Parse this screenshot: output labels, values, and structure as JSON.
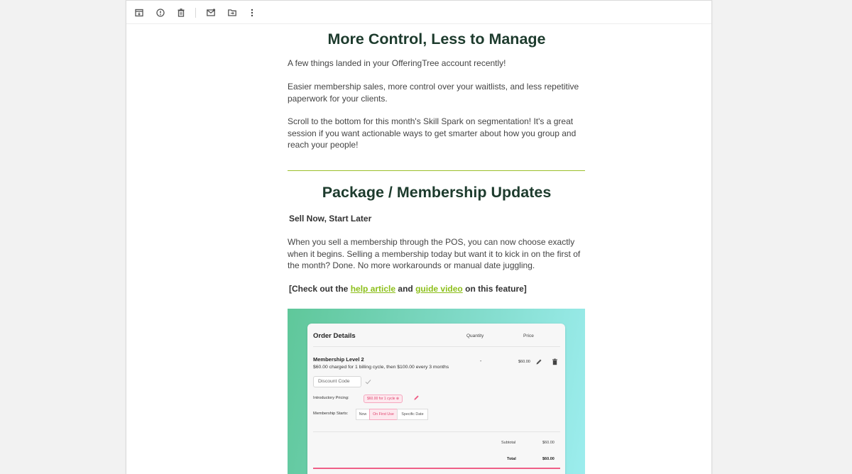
{
  "toolbar": {
    "icons": [
      "archive-icon",
      "report-spam-icon",
      "delete-icon",
      "mark-unread-icon",
      "move-to-icon",
      "more-options-icon"
    ]
  },
  "intro": {
    "title": "More Control, Less to Manage",
    "p1": "A few things landed in your OfferingTree account recently!",
    "p2": "Easier membership sales, more control over your waitlists, and less repetitive paperwork for your clients.",
    "p3": "Scroll to the bottom for this month's Skill Spark on segmentation! It's a great session if you want actionable ways to get smarter about how you group and reach your people!"
  },
  "section": {
    "title": "Package / Membership Updates",
    "subhead": "Sell Now, Start Later",
    "body": "When you sell a membership through the POS, you can now choose exactly when it begins. Selling a membership today but want it to kick in on the first of the month? Done. No more workarounds or manual date juggling.",
    "cta_prefix": "[Check out the",
    "cta_link1": "help article",
    "cta_and": "and",
    "cta_link2": "guide video",
    "cta_suffix": "on this feature]"
  },
  "order": {
    "title": "Order Details",
    "col_qty": "Quantity",
    "col_price": "Price",
    "item_name": "Membership Level 2",
    "item_desc": "$60.00 charged for 1 billing cycle, then $100.00 every 3 months",
    "item_qty": "-",
    "item_price": "$60.00",
    "discount_placeholder": "Discount Code",
    "intro_label": "Introductory Pricing:",
    "intro_pill": "$60.00 for 1 cycle",
    "starts_label": "Membership Starts:",
    "start_options": [
      "Now",
      "On First Use",
      "Specific Date"
    ],
    "selected_start": "On First Use",
    "subtotal_label": "Subtotal",
    "subtotal_value": "$60.00",
    "total_label": "Total",
    "total_value": "$60.00"
  },
  "colors": {
    "heading": "#1d3b2d",
    "link": "#8cbf1a",
    "rule": "#9bbf2a",
    "accent_pink": "#ef5f87"
  }
}
